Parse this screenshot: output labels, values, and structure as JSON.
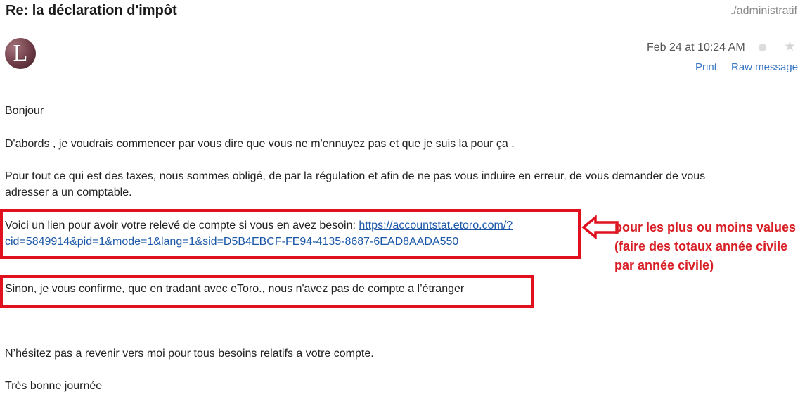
{
  "message": {
    "subject": "Re: la déclaration d'impôt",
    "folder": "./administratif",
    "sender_initial": "L",
    "date": "Feb 24 at 10:24 AM",
    "actions": {
      "print": "Print",
      "raw": "Raw message"
    }
  },
  "body": {
    "greeting": "Bonjour",
    "intro": "D'abords , je voudrais commencer par vous dire que vous ne m'ennuyez pas et que je suis la pour ça .",
    "taxes_line1": "Pour tout ce qui est des taxes, nous sommes obligé, de par la régulation et afin de ne pas vous induire en erreur, de vous demander de vous",
    "taxes_line2": "adresser a un comptable.",
    "link_intro": "Voici un lien pour avoir votre relevé de compte si vous en avez besoin: ",
    "link_part1": "https://accountstat.etoro.com/?",
    "link_part2": "cid=5849914&pid=1&mode=1&lang=1&sid=D5B4EBCF-FE94-4135-8687-6EAD8AADA550",
    "confirm": "Sinon, je vous confirme, que en tradant avec eToro., nous n'avez pas de compte a l’étranger",
    "contact": "N’hésitez pas a revenir vers moi pour tous besoins relatifs a votre compte.",
    "closing": "Très bonne journée"
  },
  "annotation": {
    "line1": "pour les plus ou moins values",
    "line2": "(faire des totaux année civile",
    "line3": "par année civile)",
    "color": "#d81e24"
  },
  "colors": {
    "link": "#1a57a8",
    "action": "#3b78c4",
    "highlight_box": "#e0101e"
  }
}
